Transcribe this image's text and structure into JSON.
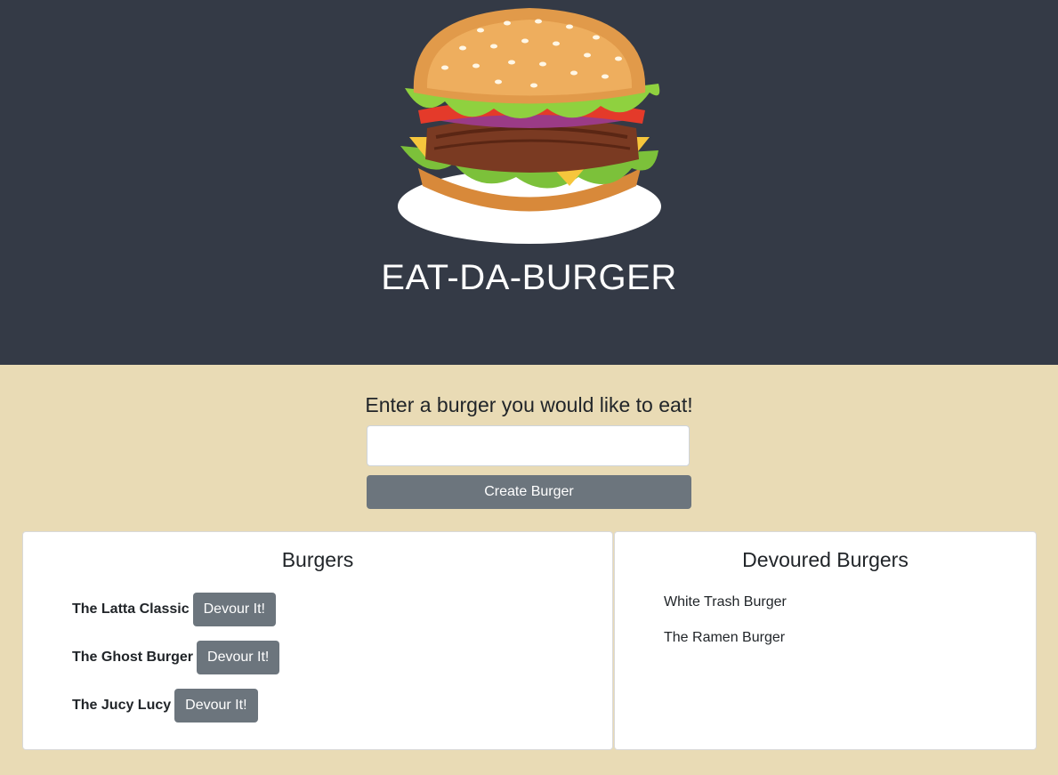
{
  "header": {
    "logo_icon": "burger-icon",
    "title": "EAT-DA-BURGER"
  },
  "form": {
    "label": "Enter a burger you would like to eat!",
    "input_value": "",
    "input_placeholder": "",
    "submit_label": "Create Burger"
  },
  "burgers": {
    "title": "Burgers",
    "items": [
      {
        "name": "The Latta Classic",
        "button": "Devour It!"
      },
      {
        "name": "The Ghost Burger",
        "button": "Devour It!"
      },
      {
        "name": "The Jucy Lucy",
        "button": "Devour It!"
      }
    ]
  },
  "devoured": {
    "title": "Devoured Burgers",
    "items": [
      {
        "name": "White Trash Burger"
      },
      {
        "name": "The Ramen Burger"
      }
    ]
  },
  "colors": {
    "header_bg": "#343a46",
    "page_bg": "#e9dbb5",
    "button_bg": "#6c757d"
  }
}
